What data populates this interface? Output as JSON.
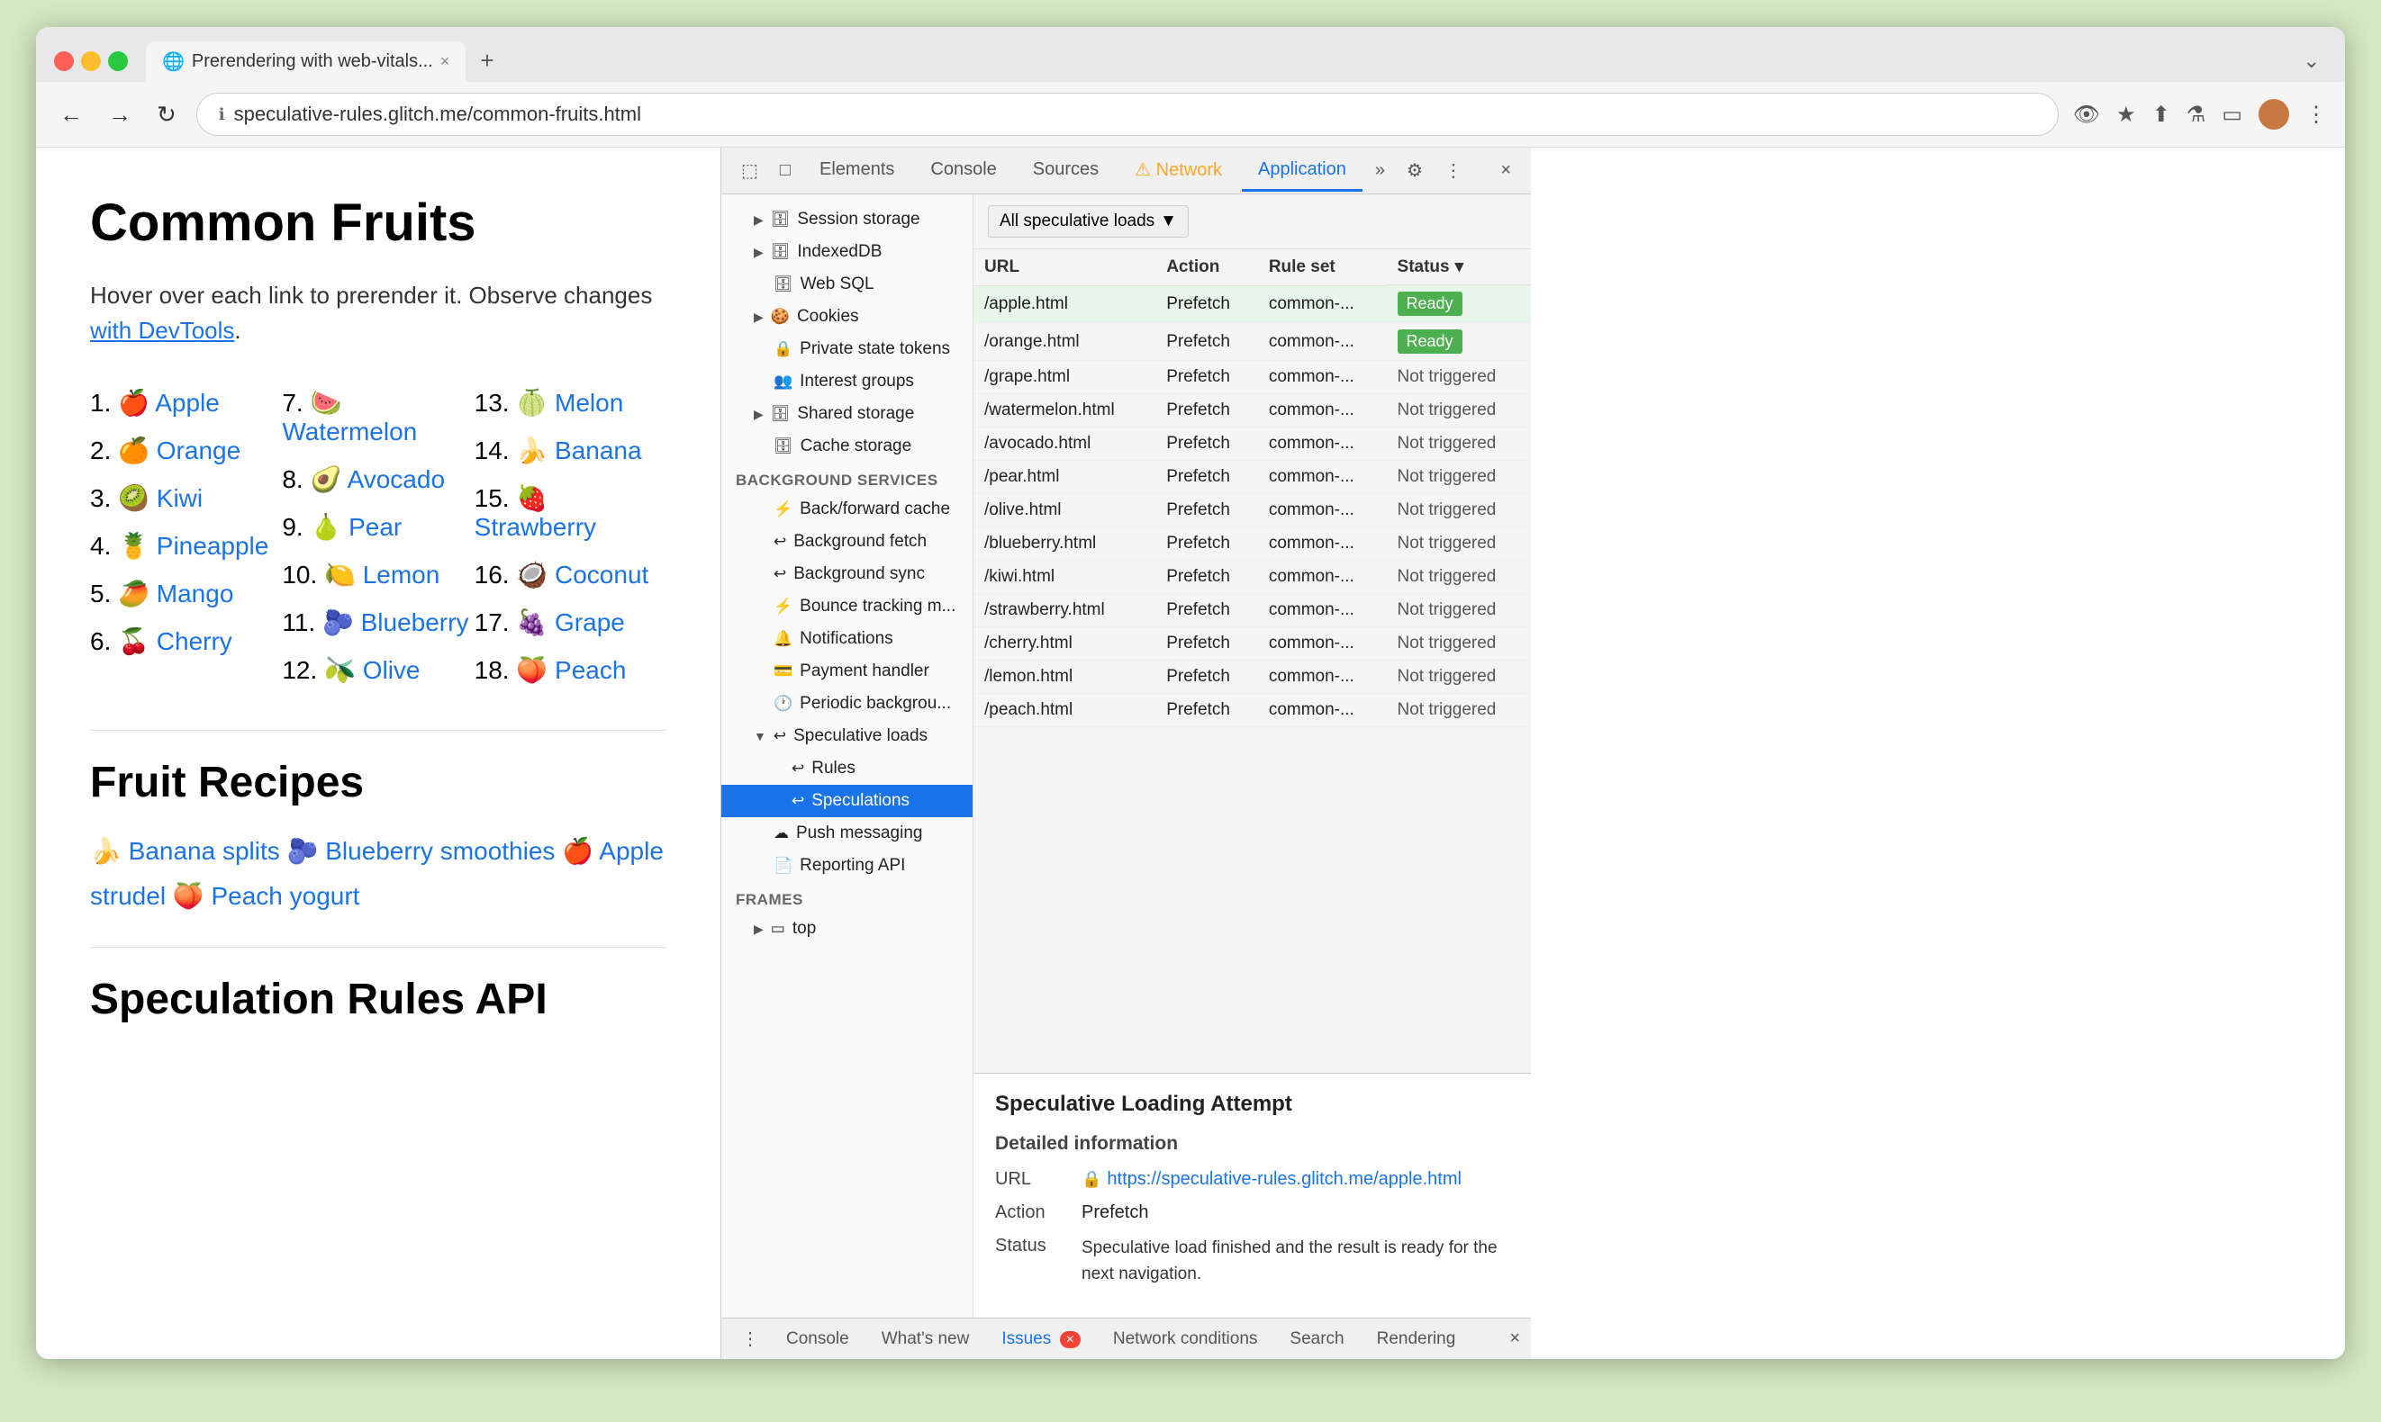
{
  "browser": {
    "traffic_lights": [
      "red",
      "yellow",
      "green"
    ],
    "tab": {
      "favicon": "🌐",
      "title": "Prerendering with web-vitals...",
      "close_label": "×"
    },
    "tab_add_label": "+",
    "tab_chevron": "⌄",
    "nav": {
      "back_label": "←",
      "forward_label": "→",
      "refresh_label": "↻",
      "address_icon": "ℹ",
      "url": "speculative-rules.glitch.me/common-fruits.html",
      "actions": [
        "👁‍🗨",
        "★",
        "⬆",
        "⚗",
        "▭",
        "👤",
        "⋮"
      ]
    }
  },
  "page": {
    "title": "Common Fruits",
    "intro": "Hover over each link to prerender it. Observe changes",
    "intro_link_text": "with DevTools",
    "intro_link_suffix": ".",
    "fruits": [
      {
        "num": "1.",
        "emoji": "🍎",
        "name": "Apple",
        "href": "#"
      },
      {
        "num": "2.",
        "emoji": "🍊",
        "name": "Orange",
        "href": "#"
      },
      {
        "num": "3.",
        "emoji": "🥝",
        "name": "Kiwi",
        "href": "#"
      },
      {
        "num": "4.",
        "emoji": "🍍",
        "name": "Pineapple",
        "href": "#"
      },
      {
        "num": "5.",
        "emoji": "🥭",
        "name": "Mango",
        "href": "#"
      },
      {
        "num": "6.",
        "emoji": "🍒",
        "name": "Cherry",
        "href": "#"
      },
      {
        "num": "7.",
        "emoji": "🍉",
        "name": "Watermelon",
        "href": "#"
      },
      {
        "num": "8.",
        "emoji": "🥑",
        "name": "Avocado",
        "href": "#"
      },
      {
        "num": "9.",
        "emoji": "🍐",
        "name": "Pear",
        "href": "#"
      },
      {
        "num": "10.",
        "emoji": "🍋",
        "name": "Lemon",
        "href": "#"
      },
      {
        "num": "11.",
        "emoji": "🫐",
        "name": "Blueberry",
        "href": "#"
      },
      {
        "num": "12.",
        "emoji": "🫒",
        "name": "Olive",
        "href": "#"
      },
      {
        "num": "13.",
        "emoji": "🍈",
        "name": "Melon",
        "href": "#"
      },
      {
        "num": "14.",
        "emoji": "🍌",
        "name": "Banana",
        "href": "#"
      },
      {
        "num": "15.",
        "emoji": "🍓",
        "name": "Strawberry",
        "href": "#"
      },
      {
        "num": "16.",
        "emoji": "🥥",
        "name": "Coconut",
        "href": "#"
      },
      {
        "num": "17.",
        "emoji": "🍇",
        "name": "Grape",
        "href": "#"
      },
      {
        "num": "18.",
        "emoji": "🍑",
        "name": "Peach",
        "href": "#"
      }
    ],
    "recipes_title": "Fruit Recipes",
    "recipes": [
      {
        "emoji": "🍌",
        "name": "Banana splits"
      },
      {
        "emoji": "🫐",
        "name": "Blueberry smoothies"
      },
      {
        "emoji": "🍎",
        "name": "Apple strudel"
      },
      {
        "emoji": "🍑",
        "name": "Peach yogurt"
      }
    ],
    "api_title": "Speculation Rules API"
  },
  "devtools": {
    "tabs": [
      "Elements",
      "Console",
      "Sources",
      "Network",
      "Application"
    ],
    "active_tab": "Application",
    "warning_tab": "Network",
    "more_tabs": "»",
    "gear_label": "⚙",
    "menu_label": "⋮",
    "close_label": "×",
    "sidebar": {
      "items": [
        {
          "label": "Session storage",
          "icon": "🗄",
          "indent": 1,
          "arrow": "▶"
        },
        {
          "label": "IndexedDB",
          "icon": "🗄",
          "indent": 1,
          "arrow": "▶"
        },
        {
          "label": "Web SQL",
          "icon": "🗄",
          "indent": 1
        },
        {
          "label": "Cookies",
          "icon": "🍪",
          "indent": 1,
          "arrow": "▶"
        },
        {
          "label": "Private state tokens",
          "icon": "🔒",
          "indent": 1
        },
        {
          "label": "Interest groups",
          "icon": "👥",
          "indent": 1
        },
        {
          "label": "Shared storage",
          "icon": "🗄",
          "indent": 1,
          "arrow": "▶"
        },
        {
          "label": "Cache storage",
          "icon": "🗄",
          "indent": 1
        },
        {
          "label": "Background services",
          "section": true
        },
        {
          "label": "Back/forward cache",
          "icon": "⚡",
          "indent": 1
        },
        {
          "label": "Background fetch",
          "icon": "↩",
          "indent": 1
        },
        {
          "label": "Background sync",
          "icon": "↩",
          "indent": 1
        },
        {
          "label": "Bounce tracking m...",
          "icon": "⚡",
          "indent": 1
        },
        {
          "label": "Notifications",
          "icon": "🔔",
          "indent": 1
        },
        {
          "label": "Payment handler",
          "icon": "💳",
          "indent": 1
        },
        {
          "label": "Periodic backgrou...",
          "icon": "🕐",
          "indent": 1
        },
        {
          "label": "Speculative loads",
          "icon": "↩",
          "indent": 1,
          "arrow": "▼"
        },
        {
          "label": "Rules",
          "icon": "↩",
          "indent": 2
        },
        {
          "label": "Speculations",
          "icon": "↩",
          "indent": 2,
          "active": true
        },
        {
          "label": "Push messaging",
          "icon": "☁",
          "indent": 1
        },
        {
          "label": "Reporting API",
          "icon": "📄",
          "indent": 1
        },
        {
          "label": "Frames",
          "section": true
        },
        {
          "label": "top",
          "icon": "▭",
          "indent": 1,
          "arrow": "▶"
        }
      ]
    },
    "spec_loads": {
      "dropdown_label": "All speculative loads",
      "columns": [
        "URL",
        "Action",
        "Rule set",
        "Status"
      ],
      "rows": [
        {
          "url": "/apple.html",
          "action": "Prefetch",
          "ruleset": "common-...",
          "status": "Ready",
          "highlighted": true
        },
        {
          "url": "/orange.html",
          "action": "Prefetch",
          "ruleset": "common-...",
          "status": "Ready"
        },
        {
          "url": "/grape.html",
          "action": "Prefetch",
          "ruleset": "common-...",
          "status": "Not triggered"
        },
        {
          "url": "/watermelon.html",
          "action": "Prefetch",
          "ruleset": "common-...",
          "status": "Not triggered"
        },
        {
          "url": "/avocado.html",
          "action": "Prefetch",
          "ruleset": "common-...",
          "status": "Not triggered"
        },
        {
          "url": "/pear.html",
          "action": "Prefetch",
          "ruleset": "common-...",
          "status": "Not triggered"
        },
        {
          "url": "/olive.html",
          "action": "Prefetch",
          "ruleset": "common-...",
          "status": "Not triggered"
        },
        {
          "url": "/blueberry.html",
          "action": "Prefetch",
          "ruleset": "common-...",
          "status": "Not triggered"
        },
        {
          "url": "/kiwi.html",
          "action": "Prefetch",
          "ruleset": "common-...",
          "status": "Not triggered"
        },
        {
          "url": "/strawberry.html",
          "action": "Prefetch",
          "ruleset": "common-...",
          "status": "Not triggered"
        },
        {
          "url": "/cherry.html",
          "action": "Prefetch",
          "ruleset": "common-...",
          "status": "Not triggered"
        },
        {
          "url": "/lemon.html",
          "action": "Prefetch",
          "ruleset": "common-...",
          "status": "Not triggered"
        },
        {
          "url": "/peach.html",
          "action": "Prefetch",
          "ruleset": "common-...",
          "status": "Not triggered"
        }
      ]
    },
    "detail": {
      "title": "Speculative Loading Attempt",
      "subtitle": "Detailed information",
      "url_label": "URL",
      "url_value": "https://speculative-rules.glitch.me/apple.html",
      "action_label": "Action",
      "action_value": "Prefetch",
      "status_label": "Status",
      "status_value": "Speculative load finished and the result is ready for the next navigation."
    },
    "bottom_tabs": [
      "Console",
      "What's new",
      "Issues",
      "Network conditions",
      "Search",
      "Rendering"
    ],
    "issues_count": "×"
  }
}
